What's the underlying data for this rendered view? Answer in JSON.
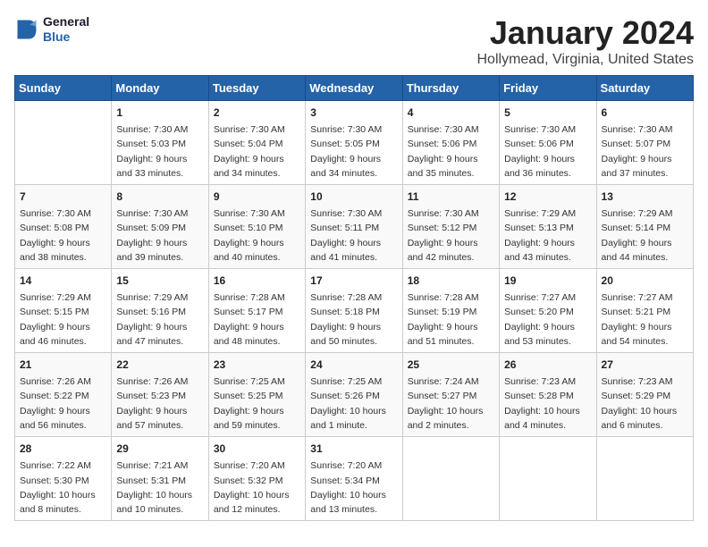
{
  "logo": {
    "text_general": "General",
    "text_blue": "Blue"
  },
  "header": {
    "title": "January 2024",
    "subtitle": "Hollymead, Virginia, United States"
  },
  "days_of_week": [
    "Sunday",
    "Monday",
    "Tuesday",
    "Wednesday",
    "Thursday",
    "Friday",
    "Saturday"
  ],
  "weeks": [
    [
      {
        "day": "",
        "content": ""
      },
      {
        "day": "1",
        "content": "Sunrise: 7:30 AM\nSunset: 5:03 PM\nDaylight: 9 hours\nand 33 minutes."
      },
      {
        "day": "2",
        "content": "Sunrise: 7:30 AM\nSunset: 5:04 PM\nDaylight: 9 hours\nand 34 minutes."
      },
      {
        "day": "3",
        "content": "Sunrise: 7:30 AM\nSunset: 5:05 PM\nDaylight: 9 hours\nand 34 minutes."
      },
      {
        "day": "4",
        "content": "Sunrise: 7:30 AM\nSunset: 5:06 PM\nDaylight: 9 hours\nand 35 minutes."
      },
      {
        "day": "5",
        "content": "Sunrise: 7:30 AM\nSunset: 5:06 PM\nDaylight: 9 hours\nand 36 minutes."
      },
      {
        "day": "6",
        "content": "Sunrise: 7:30 AM\nSunset: 5:07 PM\nDaylight: 9 hours\nand 37 minutes."
      }
    ],
    [
      {
        "day": "7",
        "content": "Sunrise: 7:30 AM\nSunset: 5:08 PM\nDaylight: 9 hours\nand 38 minutes."
      },
      {
        "day": "8",
        "content": "Sunrise: 7:30 AM\nSunset: 5:09 PM\nDaylight: 9 hours\nand 39 minutes."
      },
      {
        "day": "9",
        "content": "Sunrise: 7:30 AM\nSunset: 5:10 PM\nDaylight: 9 hours\nand 40 minutes."
      },
      {
        "day": "10",
        "content": "Sunrise: 7:30 AM\nSunset: 5:11 PM\nDaylight: 9 hours\nand 41 minutes."
      },
      {
        "day": "11",
        "content": "Sunrise: 7:30 AM\nSunset: 5:12 PM\nDaylight: 9 hours\nand 42 minutes."
      },
      {
        "day": "12",
        "content": "Sunrise: 7:29 AM\nSunset: 5:13 PM\nDaylight: 9 hours\nand 43 minutes."
      },
      {
        "day": "13",
        "content": "Sunrise: 7:29 AM\nSunset: 5:14 PM\nDaylight: 9 hours\nand 44 minutes."
      }
    ],
    [
      {
        "day": "14",
        "content": "Sunrise: 7:29 AM\nSunset: 5:15 PM\nDaylight: 9 hours\nand 46 minutes."
      },
      {
        "day": "15",
        "content": "Sunrise: 7:29 AM\nSunset: 5:16 PM\nDaylight: 9 hours\nand 47 minutes."
      },
      {
        "day": "16",
        "content": "Sunrise: 7:28 AM\nSunset: 5:17 PM\nDaylight: 9 hours\nand 48 minutes."
      },
      {
        "day": "17",
        "content": "Sunrise: 7:28 AM\nSunset: 5:18 PM\nDaylight: 9 hours\nand 50 minutes."
      },
      {
        "day": "18",
        "content": "Sunrise: 7:28 AM\nSunset: 5:19 PM\nDaylight: 9 hours\nand 51 minutes."
      },
      {
        "day": "19",
        "content": "Sunrise: 7:27 AM\nSunset: 5:20 PM\nDaylight: 9 hours\nand 53 minutes."
      },
      {
        "day": "20",
        "content": "Sunrise: 7:27 AM\nSunset: 5:21 PM\nDaylight: 9 hours\nand 54 minutes."
      }
    ],
    [
      {
        "day": "21",
        "content": "Sunrise: 7:26 AM\nSunset: 5:22 PM\nDaylight: 9 hours\nand 56 minutes."
      },
      {
        "day": "22",
        "content": "Sunrise: 7:26 AM\nSunset: 5:23 PM\nDaylight: 9 hours\nand 57 minutes."
      },
      {
        "day": "23",
        "content": "Sunrise: 7:25 AM\nSunset: 5:25 PM\nDaylight: 9 hours\nand 59 minutes."
      },
      {
        "day": "24",
        "content": "Sunrise: 7:25 AM\nSunset: 5:26 PM\nDaylight: 10 hours\nand 1 minute."
      },
      {
        "day": "25",
        "content": "Sunrise: 7:24 AM\nSunset: 5:27 PM\nDaylight: 10 hours\nand 2 minutes."
      },
      {
        "day": "26",
        "content": "Sunrise: 7:23 AM\nSunset: 5:28 PM\nDaylight: 10 hours\nand 4 minutes."
      },
      {
        "day": "27",
        "content": "Sunrise: 7:23 AM\nSunset: 5:29 PM\nDaylight: 10 hours\nand 6 minutes."
      }
    ],
    [
      {
        "day": "28",
        "content": "Sunrise: 7:22 AM\nSunset: 5:30 PM\nDaylight: 10 hours\nand 8 minutes."
      },
      {
        "day": "29",
        "content": "Sunrise: 7:21 AM\nSunset: 5:31 PM\nDaylight: 10 hours\nand 10 minutes."
      },
      {
        "day": "30",
        "content": "Sunrise: 7:20 AM\nSunset: 5:32 PM\nDaylight: 10 hours\nand 12 minutes."
      },
      {
        "day": "31",
        "content": "Sunrise: 7:20 AM\nSunset: 5:34 PM\nDaylight: 10 hours\nand 13 minutes."
      },
      {
        "day": "",
        "content": ""
      },
      {
        "day": "",
        "content": ""
      },
      {
        "day": "",
        "content": ""
      }
    ]
  ]
}
